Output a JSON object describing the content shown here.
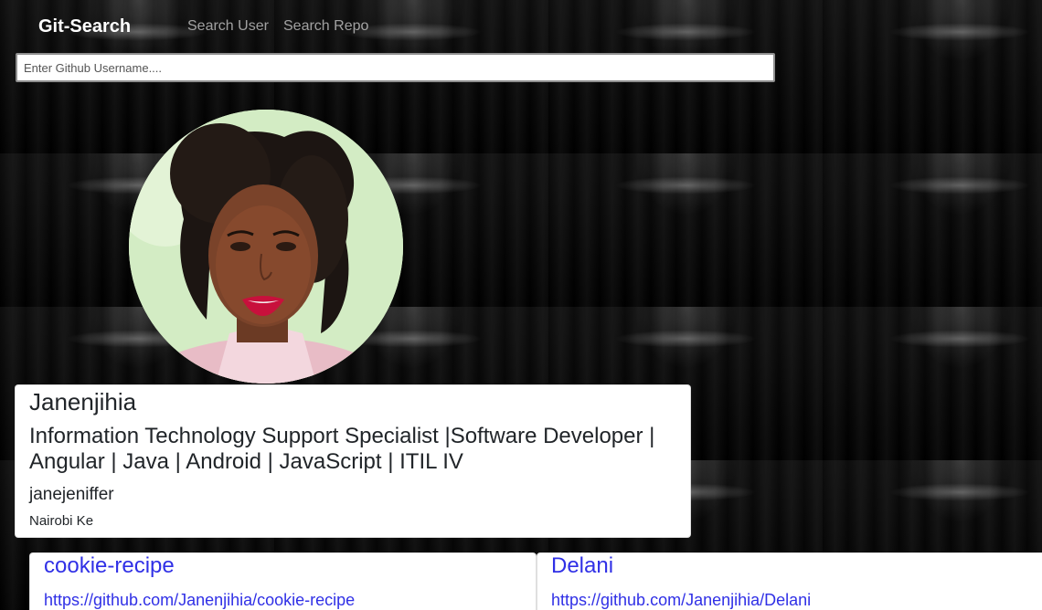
{
  "navbar": {
    "brand": "Git-Search",
    "links": [
      {
        "label": "Search User"
      },
      {
        "label": "Search Repo"
      }
    ]
  },
  "search": {
    "placeholder": "Enter Github Username....",
    "value": ""
  },
  "profile": {
    "avatar_icon": "user-avatar-photo",
    "name": "Janenjihia",
    "bio": "Information Technology Support Specialist |Software Developer | Angular | Java | Android | JavaScript | ITIL IV",
    "login": "janejeniffer",
    "location": "Nairobi Ke"
  },
  "repos": [
    {
      "name": "cookie-recipe",
      "url": "https://github.com/Janenjihia/cookie-recipe"
    },
    {
      "name": "Delani",
      "url": "https://github.com/Janenjihia/Delani"
    }
  ],
  "colors": {
    "link": "#3030e6",
    "brand": "#ffffff",
    "nav_link": "rgba(255,255,255,0.6)",
    "background": "#050505"
  }
}
